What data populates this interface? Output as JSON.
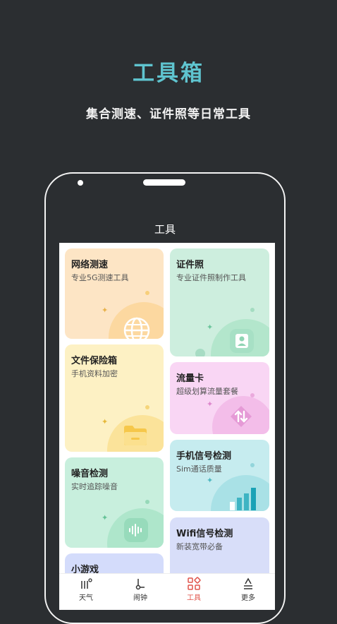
{
  "promo": {
    "title": "工具箱",
    "subtitle": "集合测速、证件照等日常工具"
  },
  "screen": {
    "title": "工具"
  },
  "cards": [
    {
      "title": "网络测速",
      "subtitle": "专业5G测速工具",
      "color": "#fde5c5",
      "icon": "globe-icon"
    },
    {
      "title": "证件照",
      "subtitle": "专业证件照制作工具",
      "color": "#cdeede",
      "icon": "id-photo-icon"
    },
    {
      "title": "文件保险箱",
      "subtitle": "手机资料加密",
      "color": "#fdf1c4",
      "icon": "folder-icon"
    },
    {
      "title": "流量卡",
      "subtitle": "超级划算流量套餐",
      "color": "#f9d6f4",
      "icon": "data-transfer-icon"
    },
    {
      "title": "噪音检测",
      "subtitle": "实时追踪噪音",
      "color": "#c8efdd",
      "icon": "sound-wave-icon"
    },
    {
      "title": "手机信号检测",
      "subtitle": "Sim通话质量",
      "color": "#c6ecef",
      "icon": "signal-bars-icon"
    },
    {
      "title": "小游戏",
      "subtitle": "",
      "color": "#d4dcfb",
      "icon": ""
    },
    {
      "title": "Wifi信号检测",
      "subtitle": "新装宽带必备",
      "color": "#d8def9",
      "icon": ""
    }
  ],
  "tabs": [
    {
      "label": "天气",
      "icon": "weather-icon",
      "active": false
    },
    {
      "label": "闹钟",
      "icon": "alarm-icon",
      "active": false
    },
    {
      "label": "工具",
      "icon": "tools-grid-icon",
      "active": true
    },
    {
      "label": "更多",
      "icon": "more-icon",
      "active": false
    }
  ],
  "colors": {
    "accent": "#5fc4cf",
    "tab_active": "#e0534a",
    "background": "#2b2e31"
  }
}
